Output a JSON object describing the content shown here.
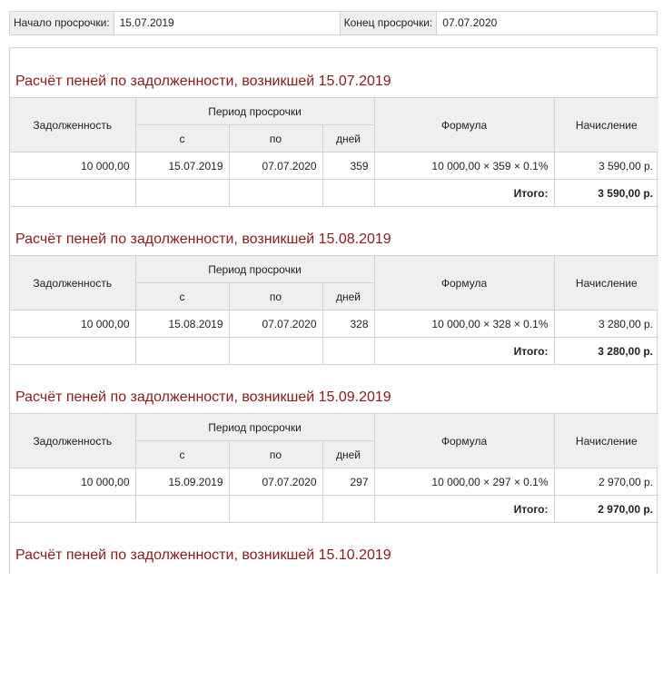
{
  "period": {
    "start_label": "Начало просрочки:",
    "start_value": "15.07.2019",
    "end_label": "Конец просрочки:",
    "end_value": "07.07.2020"
  },
  "headers": {
    "debt": "Задолженность",
    "period": "Период просрочки",
    "from": "с",
    "to": "по",
    "days": "дней",
    "formula": "Формула",
    "accrual": "Начисление",
    "total_label": "Итого:"
  },
  "sections": [
    {
      "title": "Расчёт пеней по задолженности, возникшей 15.07.2019",
      "debt": "10 000,00",
      "from": "15.07.2019",
      "to": "07.07.2020",
      "days": "359",
      "formula": "10 000,00 × 359 × 0.1%",
      "accrual": "3 590,00 р.",
      "total": "3 590,00 р."
    },
    {
      "title": "Расчёт пеней по задолженности, возникшей 15.08.2019",
      "debt": "10 000,00",
      "from": "15.08.2019",
      "to": "07.07.2020",
      "days": "328",
      "formula": "10 000,00 × 328 × 0.1%",
      "accrual": "3 280,00 р.",
      "total": "3 280,00 р."
    },
    {
      "title": "Расчёт пеней по задолженности, возникшей 15.09.2019",
      "debt": "10 000,00",
      "from": "15.09.2019",
      "to": "07.07.2020",
      "days": "297",
      "formula": "10 000,00 × 297 × 0.1%",
      "accrual": "2 970,00 р.",
      "total": "2 970,00 р."
    },
    {
      "title": "Расчёт пеней по задолженности, возникшей 15.10.2019"
    }
  ]
}
